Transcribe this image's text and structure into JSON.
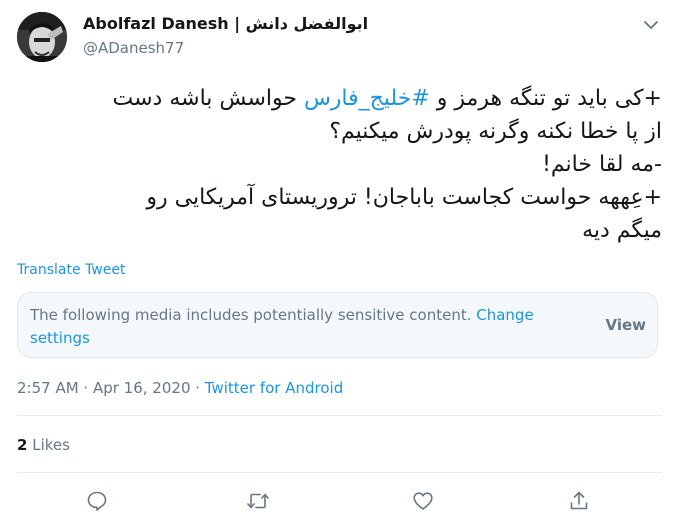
{
  "author": {
    "name": "Abolfazl Danesh | ابوالفضل دانش",
    "handle": "@ADanesh77"
  },
  "tweet": {
    "line1_prefix": "+کی باید تو تنگه هرمز و ",
    "line1_hashtag": "#خلیج_فارس",
    "line1_suffix": " حواسش باشه دست",
    "line2": "از پا خطا نکنه وگرنه پودرش میکنیم؟",
    "line3": "-مه لقا خانم!",
    "line4": "+عِههه حواست کجاست باباجان! تروریستای آمریکایی رو",
    "line5": "میگم دیه"
  },
  "translate_label": "Translate Tweet",
  "sensitive": {
    "message": "The following media includes potentially sensitive content. ",
    "link": "Change settings",
    "view_label": "View"
  },
  "meta": {
    "time": "2:57 AM",
    "separator1": " · ",
    "date": "Apr 16, 2020",
    "separator2": " · ",
    "source": "Twitter for Android"
  },
  "likes": {
    "count": "2",
    "label": " Likes"
  },
  "icons": {
    "caret": "chevron-down-icon",
    "reply": "reply-icon",
    "retweet": "retweet-icon",
    "like": "heart-icon",
    "share": "share-icon"
  },
  "colors": {
    "accent": "#1b95e0",
    "text": "#14171a",
    "secondary": "#657786",
    "border": "#e1e8ed",
    "box_bg": "#f5f8fa"
  }
}
